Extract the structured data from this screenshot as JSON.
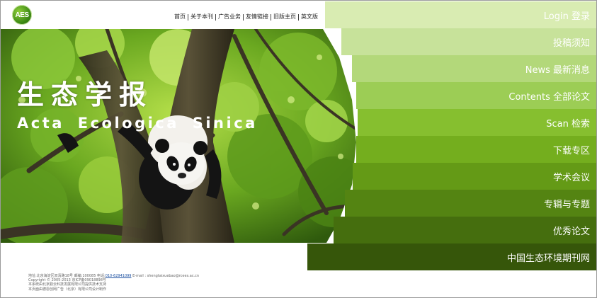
{
  "logo": {
    "text": "AES"
  },
  "topnav": [
    {
      "label": "首页"
    },
    {
      "label": "关于本刊"
    },
    {
      "label": "广告业务"
    },
    {
      "label": "友情链接"
    },
    {
      "label": "旧版主页"
    },
    {
      "label": "英文版"
    }
  ],
  "hero": {
    "title_cn": "生态学报",
    "title_en": "Acta Ecologica Sinica"
  },
  "menu": [
    {
      "label": "Login 登录",
      "color": "#d9ecb2"
    },
    {
      "label": "投稿须知",
      "color": "#c7e29a"
    },
    {
      "label": "News 最新消息",
      "color": "#b3d87a"
    },
    {
      "label": "Contents 全部论文",
      "color": "#9ccd55"
    },
    {
      "label": "Scan 检索",
      "color": "#86bf2f"
    },
    {
      "label": "下载专区",
      "color": "#74ae1e"
    },
    {
      "label": "学术会议",
      "color": "#649a16"
    },
    {
      "label": "专辑与专题",
      "color": "#548412"
    },
    {
      "label": "优秀论文",
      "color": "#456e0e"
    },
    {
      "label": "中国生态环境期刊网",
      "color": "#36560a"
    }
  ],
  "footer": {
    "line1_prefix": "地址:北京海淀区双清路18号 邮编:100085 电话:",
    "phone": "010-62941099",
    "line1_suffix": " E-mail : shengtaixuebao@rcees.ac.cn",
    "line2": "Copyright © 2005-2013 京ICP备09018898号",
    "line3": "本系统由北京勤云科技发展有限公司提供技术支持",
    "line4": "本页面由德恩创网广告（北京）有限公司设计制作"
  }
}
